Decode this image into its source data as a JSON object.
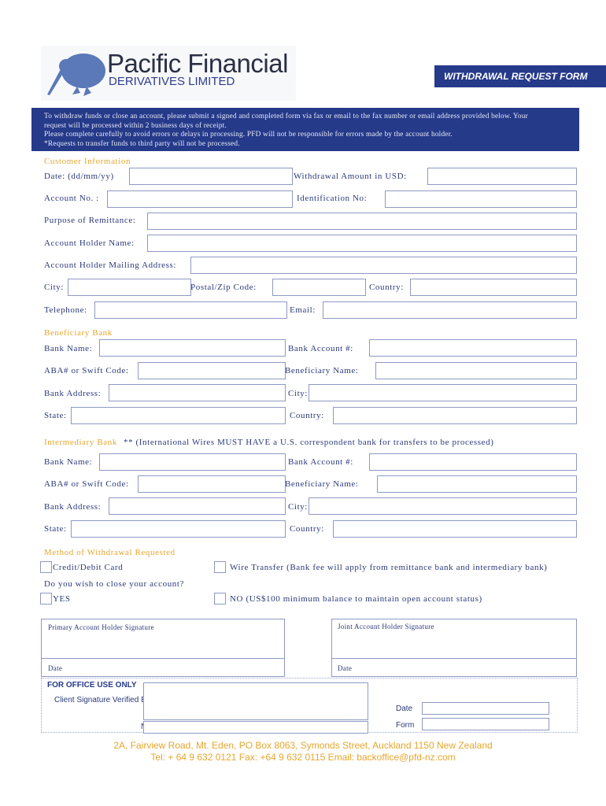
{
  "header": {
    "company_name": "Pacific Financial",
    "company_subtitle": "DERIVATIVES LIMITED",
    "form_title": "WITHDRAWAL REQUEST FORM"
  },
  "intro": {
    "line1": "To withdraw funds or close an account, please submit a signed and completed form via fax or email to the fax number or email address provided below. Your",
    "line2": "request will be processed within 2 business days of receipt.",
    "line3": "Please complete carefully to avoid errors or delays in processing. PFD will not be responsible for errors made by the account holder.",
    "line4": "*Requests to transfer funds to third party will not be processed."
  },
  "customer": {
    "heading": "Customer Information",
    "date_label": "Date: (dd/mm/yy)",
    "amount_label": "Withdrawal Amount in USD:",
    "account_no_label": "Account No. :",
    "identification_label": "Identification No:",
    "purpose_label": "Purpose of Remittance:",
    "holder_name_label": "Account Holder Name:",
    "mailing_address_label": "Account Holder Mailing Address:",
    "city_label": "City:",
    "postal_label": "Postal/Zip Code:",
    "country_label": "Country:",
    "telephone_label": "Telephone:",
    "email_label": "Email:"
  },
  "beneficiary": {
    "heading": "Beneficiary Bank",
    "bank_name_label": "Bank Name:",
    "bank_account_label": "Bank Account #:",
    "aba_label": "ABA# or Swift Code:",
    "beneficiary_name_label": "Beneficiary Name:",
    "bank_address_label": "Bank Address:",
    "city_label": "City:",
    "state_label": "State:",
    "country_label": "Country:"
  },
  "intermediary": {
    "heading": "Intermediary Bank",
    "note": "** (International Wires MUST HAVE a U.S. correspondent bank for transfers to be processed)",
    "bank_name_label": "Bank Name:",
    "bank_account_label": "Bank Account #:",
    "aba_label": "ABA# or Swift Code:",
    "beneficiary_name_label": "Beneficiary Name:",
    "bank_address_label": "Bank Address:",
    "city_label": "City:",
    "state_label": "State:",
    "country_label": "Country:"
  },
  "method": {
    "heading": "Method of Withdrawal Requested",
    "credit_card_label": "Credit/Debit Card",
    "wire_label": "Wire Transfer (Bank fee will apply from remittance bank and intermediary bank)",
    "close_question": "Do you wish to close your account?",
    "yes_label": "YES",
    "no_label": "NO (US$100 minimum balance to maintain open account status)"
  },
  "signatures": {
    "primary_label": "Primary Account Holder Signature",
    "joint_label": "Joint Account Holder Signature",
    "primary_date_label": "Date",
    "joint_date_label": "Date"
  },
  "office": {
    "heading": "FOR OFFICE USE ONLY",
    "verified_label": "Client Signature Verified By",
    "name_label": "Name",
    "date_label": "Date",
    "form_label": "Form"
  },
  "footer": {
    "address": "2A, Fairview Road, Mt. Eden, PO Box 8063, Symonds Street, Auckland 1150 New Zealand",
    "contact": "Tel: + 64 9 632 0121  Fax: +64 9 632 0115  Email: backoffice@pfd-nz.com"
  }
}
